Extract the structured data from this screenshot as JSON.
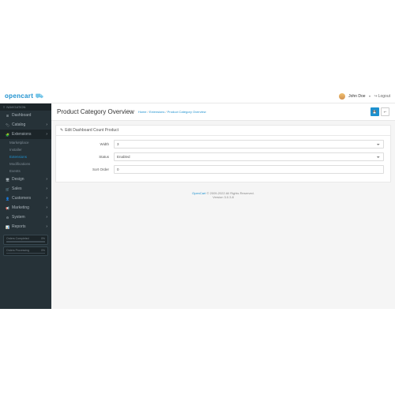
{
  "header": {
    "logo_main": "opencart",
    "username": "John Doe",
    "logout_label": "Logout"
  },
  "sidebar": {
    "nav_header": "NAVIGATION",
    "items": [
      {
        "icon": "⊞",
        "label": "Dashboard"
      },
      {
        "icon": "🏷",
        "label": "Catalog"
      },
      {
        "icon": "🧩",
        "label": "Extensions"
      }
    ],
    "sub_items": [
      {
        "label": "Marketplace"
      },
      {
        "label": "Installer"
      },
      {
        "label": "Extensions"
      },
      {
        "label": "Modifications"
      },
      {
        "label": "Events"
      }
    ],
    "items2": [
      {
        "icon": "🖥",
        "label": "Design"
      },
      {
        "icon": "🛒",
        "label": "Sales"
      },
      {
        "icon": "👤",
        "label": "Customers"
      },
      {
        "icon": "📢",
        "label": "Marketing"
      },
      {
        "icon": "⚙",
        "label": "System"
      },
      {
        "icon": "📊",
        "label": "Reports"
      }
    ],
    "widgets": [
      {
        "label": "Orders Completed",
        "pct": "0%"
      },
      {
        "label": "Orders Processing",
        "pct": "0%"
      }
    ]
  },
  "page": {
    "title": "Product Category Overview",
    "breadcrumb": {
      "home": "Home",
      "ext": "Extensions",
      "current": "Product Category Overview"
    },
    "panel_title": "Edit Dashboard Count Product",
    "form": {
      "width_label": "Width",
      "width_value": "3",
      "status_label": "Status",
      "status_value": "Enabled",
      "sort_label": "Sort Order",
      "sort_value": "0"
    }
  },
  "footer": {
    "brand": "OpenCart",
    "copy": " © 2009-2022 All Rights Reserved.",
    "version": "Version 3.0.3.8"
  }
}
